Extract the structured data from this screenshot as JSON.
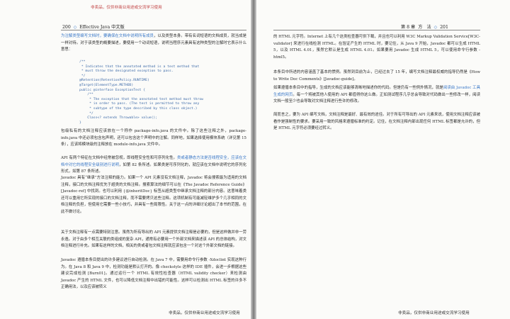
{
  "watermark": "非卖品，仅供非商业用途或交流学习使用",
  "footer_mark": "非卖品，仅供非商业用途或交流学习使用",
  "left_page": {
    "page_number": "200",
    "running_title": "Effective Java 中文版",
    "intro_highlight": "为注解类型编写文档时，要确保在文档中说明所有成员",
    "intro_rest": "，以及类型本身。带有名词短语的文档成员，就当成是一样对待。对于该类型的概要描述，要使用一个动词短语，说明当程序元素具有这种类型的注解时它表示什么意思：",
    "code": "/**\n * Indicates that the annotated method is a test method that\n * must throw the designated exception to pass.\n */\n@Retention(RetentionPolicy.RUNTIME)\n@Target(ElementType.METHOD)\npublic @interface ExceptionTest {\n    /**\n     * The exception that the annotated test method must throw\n     * in order to pass. (The test is permitted to throw any\n     * subtype of the type described by this class object.)\n     */\n    Class<? extends Throwable> value();\n}",
    "p1": "包级私有的文档注释应该放在一个称作 package-info.java 的文件中。除了这些注释之外，package-info.java 中还必须包含包声明，还可以包含这个声明中的注解。同样地，如果选择使用模块系统（详见第 15 条），应该将模块级的注释放在 module-info.java 文件中。",
    "p2_a": "API 有两个特征在文档中经常被忽视，即线程安全性和可序列化性。",
    "p2_hl": "类或者静态方法是否线程安全，应该在文档中对它的线程安全级别进行说明",
    "p2_b": "，如第 82 条所述。如果类是可序列化的，就应该在文档中说明它的序列化形式，如第 87 条所述。",
    "p3": "Javadoc 具有“继承”方法注释的能力。如果一个 API 元素没有文档注释，Javadoc 将会搜索最为适用的文档注释，接口的文档注释优先于超类的文档注释。搜索算法的细节可以在《The Javadoc Reference Guide》[Javadoc-ref] 中找到。也可以利用 {@inheritDoc} 标签从超类型中继承文档注释的部分内容。这意味着类还可以重用它所实现的接口的文档注释，而不需要拷贝这些注释。这项机制有可能减轻维护多个几乎相同的文档注释的负担，但使用它需要一些小技巧，并具有一些局限性。关于这一点的详细讨论超出了本书的范围，在此不做讨论。",
    "p4": "关于文档注释有一点需要特别注意。虽然为所有导出的 API 元素提供文档注释是必要的，但是这样做并非一劳永逸。对于由多个相互关联的类组成的复杂 API，通常有必要用一个外部文档来描述该 API 的总体结构，对文档注释进行补充。如果有这样的文档，相关的类或者包文档注释就应该包含一个对这个外部文档的链接。",
    "p5": "Javadoc 遵循本条目提出的许多建议进行自动检测。在 Java 7 中，需要用命令行参数 -Xdoclint 实现这种行为。在 Java 8 和 Java 9 中，检测功能是默认打开的。像 checkstyle 这样的 IDE 插件，会进一步根据这些建议完成检测 [Burn01]。通过运行一个 HTML 有效性检查器（HTML validity checker）来检测由 Javadoc 产生的 HTML 文件，也可以降低文档注释中出错的可能性。这样可以检测出 HTML 标签的许多不正确用法，以及应该被转义"
  },
  "right_page": {
    "chapter": "第 8 章",
    "section": "方　法",
    "page_number": "201",
    "p1": "的 HTML 元字符。Internet 上有几个这类检查器可供下载，并且也可以利用 W3C Markup Validation Service[W3C-validator] 来进行在线检测 HTML。在验证产生的 HTML 时，要记住，从 Java 9 开始，Javadoc 都可以生成 HTML 5，以及 HTML 4.01，虽然它默认是生成 HTML 4.01。如果要用 Javadoc 生成 HTML 5，可以使用命令行参数 -html5。",
    "p2": "本条目中所述的内容涵盖了基本的惯例。虽然到目前为止，已经过去了 15 年，编写文档注释最权威的指导仍然是《How to Write Doc Comments》[Javadoc-guide]。",
    "p3_a": "如果遵循本条目中的指导，生成的文档应该能够清晰地描述你的代码。但是仍有一些例外情况，就是",
    "p3_hl": "阅读由 Javadoc 工具生成的网页",
    "p3_b": "。每一个将被其他人使用的 API 都值得你这么做。正如测试程序几乎总会导致对代码做出一些修改一样，阅读文档一般至少也会导致对文档注释进行些许的修改。",
    "p4": "简而言之，要为 API 编写文档，文档注释是最好、最有效的途径。对于所有可导出的 API 元素来说，使用文档注释应该被看作是强制性的要求。要采用一致的风格来遵循标准的约定。记住，在文档注释内部出现任何 HTML 标签都是允许的，但是 HTML 元字符必须要经过转义。"
  }
}
